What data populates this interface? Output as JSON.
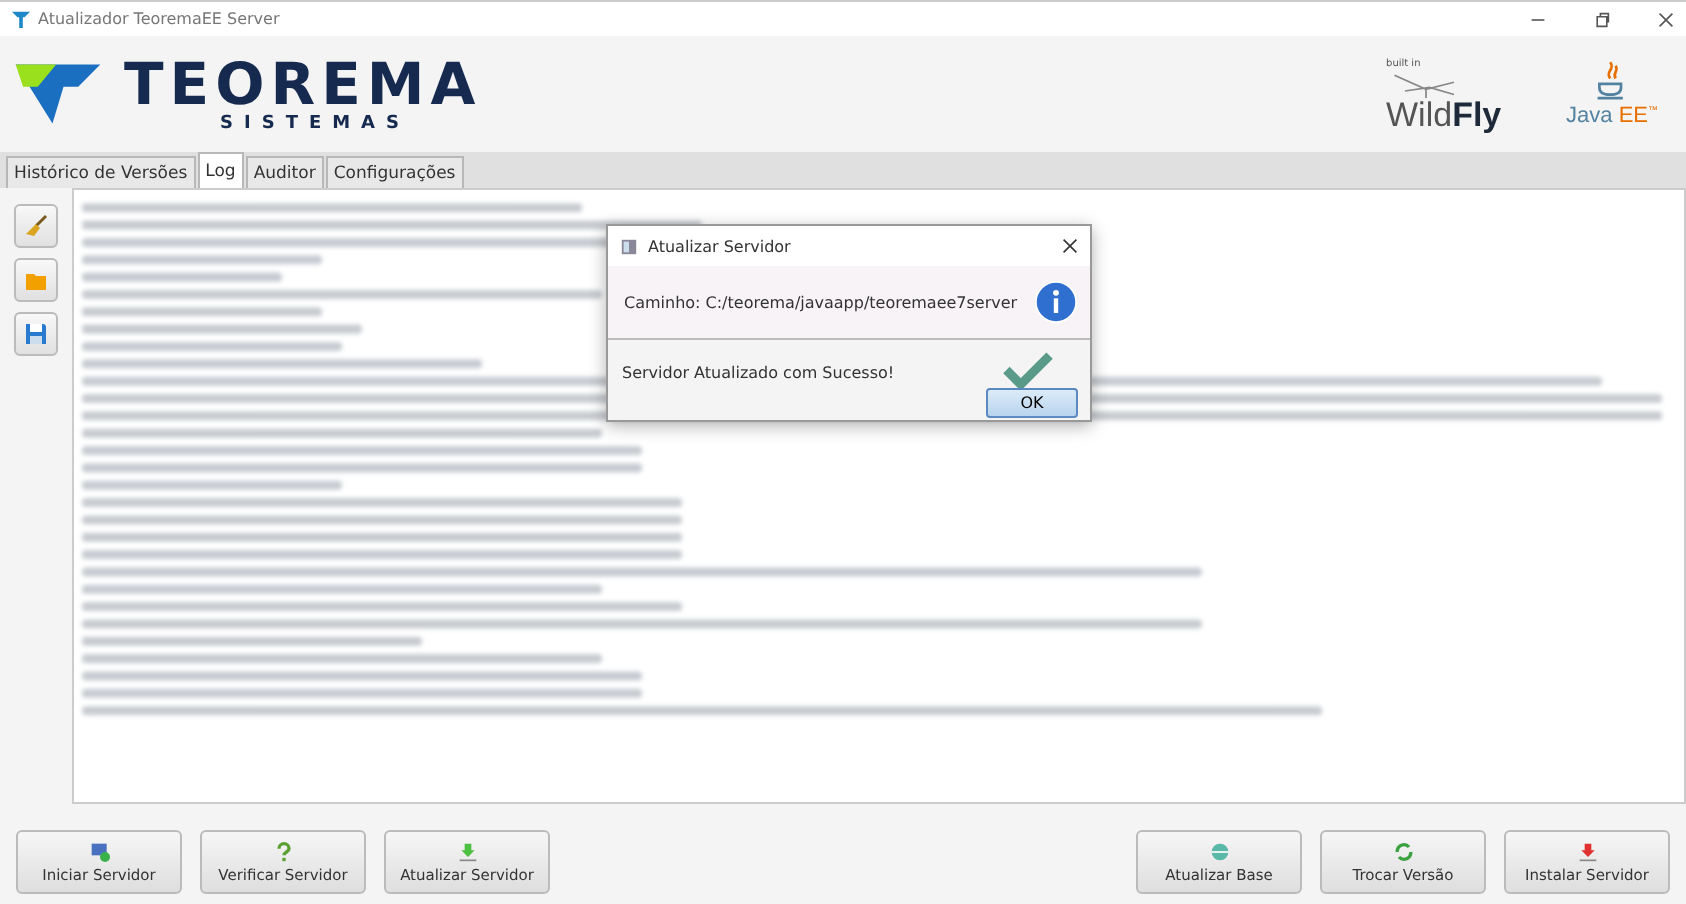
{
  "window": {
    "title": "Atualizador TeoremaEE Server"
  },
  "header": {
    "brand": "TEOREMA",
    "brand_sub": "SISTEMAS",
    "wildfly_prefix": "built in",
    "wildfly_light": "Wild",
    "wildfly_bold": "Fly",
    "javaee_a": "Java",
    "javaee_b": "EE",
    "javaee_tm": "™"
  },
  "tabs": [
    {
      "label": "Histórico de Versões",
      "selected": false
    },
    {
      "label": "Log",
      "selected": true
    },
    {
      "label": "Auditor",
      "selected": false
    },
    {
      "label": "Configurações",
      "selected": false
    }
  ],
  "tools": [
    {
      "kind": "broom"
    },
    {
      "kind": "folder"
    },
    {
      "kind": "save"
    }
  ],
  "dialog": {
    "title": "Atualizar Servidor",
    "message": "Caminho: C:/teorema/javaapp/teoremaee7server",
    "detail": "Servidor Atualizado com Sucesso!",
    "button": "OK"
  },
  "buttons_left": [
    {
      "label": "Iniciar Servidor",
      "kind": "monitor"
    },
    {
      "label": "Verificar Servidor",
      "kind": "question"
    },
    {
      "label": "Atualizar Servidor",
      "kind": "download-green"
    }
  ],
  "buttons_right": [
    {
      "label": "Atualizar Base",
      "kind": "database"
    },
    {
      "label": "Trocar Versão",
      "kind": "swap"
    },
    {
      "label": "Instalar Servidor",
      "kind": "download-red"
    }
  ]
}
